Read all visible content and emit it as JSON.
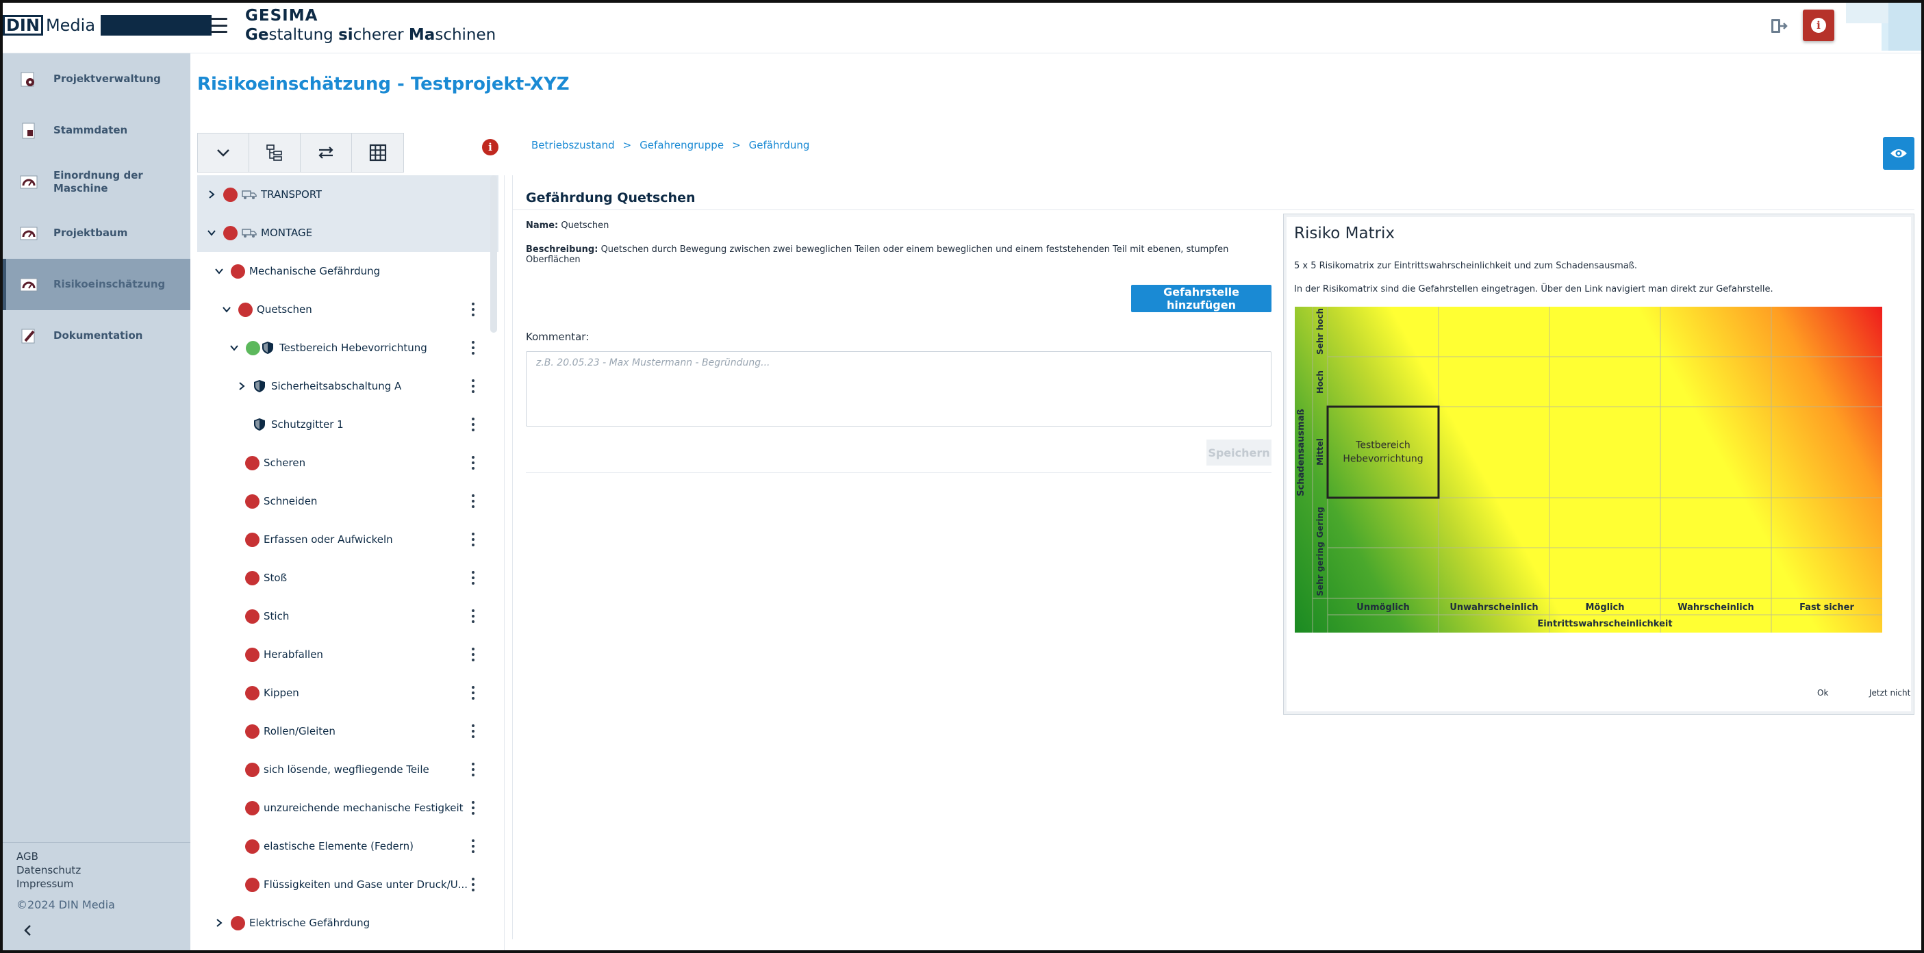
{
  "header": {
    "logo_din": "DIN",
    "logo_media": "Media",
    "app_name": "GESIMA",
    "subtitle_parts": [
      "Ge",
      "staltung ",
      "si",
      "cherer ",
      "Ma",
      "schinen"
    ]
  },
  "sidebar": {
    "items": [
      {
        "label": "Projektverwaltung",
        "icon": "gear-icon"
      },
      {
        "label": "Stammdaten",
        "icon": "file-icon"
      },
      {
        "label": "Einordnung der Maschine",
        "icon": "gauge-icon"
      },
      {
        "label": "Projektbaum",
        "icon": "gauge-icon"
      },
      {
        "label": "Risikoeinschätzung",
        "icon": "gauge-icon"
      },
      {
        "label": "Dokumentation",
        "icon": "pen-icon"
      }
    ],
    "footer": {
      "agb": "AGB",
      "datenschutz": "Datenschutz",
      "impressum": "Impressum",
      "copyright": "©2024 DIN Media"
    }
  },
  "main": {
    "title": "Risikoeinschätzung - Testprojekt-XYZ",
    "breadcrumb": [
      "Betriebszustand",
      "Gefahrengruppe",
      "Gefährdung"
    ],
    "breadcrumb_sep": ">"
  },
  "tree": {
    "rows": [
      {
        "label": "TRANSPORT",
        "level": 0
      },
      {
        "label": "MONTAGE",
        "level": 0
      },
      {
        "label": "Mechanische Gefährdung",
        "level": 1
      },
      {
        "label": "Quetschen",
        "level": 2
      },
      {
        "label": "Testbereich Hebevorrichtung",
        "level": 3
      },
      {
        "label": "Sicherheitsabschaltung A",
        "level": 4
      },
      {
        "label": "Schutzgitter 1",
        "level": 4
      },
      {
        "label": "Scheren",
        "level": 2
      },
      {
        "label": "Schneiden",
        "level": 2
      },
      {
        "label": "Erfassen oder Aufwickeln",
        "level": 2
      },
      {
        "label": "Stoß",
        "level": 2
      },
      {
        "label": "Stich",
        "level": 2
      },
      {
        "label": "Herabfallen",
        "level": 2
      },
      {
        "label": "Kippen",
        "level": 2
      },
      {
        "label": "Rollen/Gleiten",
        "level": 2
      },
      {
        "label": "sich lösende, wegfliegende Teile",
        "level": 2
      },
      {
        "label": "unzureichende mechanische Festigkeit",
        "level": 2
      },
      {
        "label": "elastische Elemente (Federn)",
        "level": 2
      },
      {
        "label": "Flüssigkeiten und Gase unter Druck/U...",
        "level": 2
      },
      {
        "label": "Elektrische Gefährdung",
        "level": 1
      }
    ]
  },
  "details": {
    "title": "Gefährdung Quetschen",
    "name_label": "Name:",
    "name_value": "Quetschen",
    "desc_label": "Beschreibung:",
    "desc_value": "Quetschen durch Bewegung zwischen zwei beweglichen Teilen oder einem beweglichen und einem feststehenden Teil mit ebenen, stumpfen Oberflächen",
    "add_button": "Gefahrstelle hinzufügen",
    "comment_label": "Kommentar:",
    "comment_placeholder": "z.B. 20.05.23 - Max Mustermann - Begründung...",
    "save_button": "Speichern"
  },
  "matrix": {
    "title": "Risiko Matrix",
    "text1": "5 x 5 Risikomatrix zur Eintrittswahrscheinlichkeit und zum Schadensausmaß.",
    "text2": "In der Risikomatrix sind die Gefahrstellen eingetragen. Über den Link navigiert man direkt zur Gefahrstelle.",
    "y_axis": "Schadensausmaß",
    "x_axis": "Eintrittswahrscheinlichkeit",
    "y_levels": [
      "Sehr hoch",
      "Hoch",
      "Mittel",
      "Gering",
      "Sehr gering"
    ],
    "x_levels": [
      "Unmöglich",
      "Unwahrscheinlich",
      "Möglich",
      "Wahrscheinlich",
      "Fast sicher"
    ],
    "marker_line1": "Testbereich",
    "marker_line2": "Hebevorrichtung",
    "marker_col": "Unmöglich",
    "marker_row": "Mittel",
    "ok": "Ok",
    "later": "Jetzt nicht"
  },
  "colors": {
    "accent": "#1a8ad4",
    "danger": "#c73234",
    "ok": "#5cb85c",
    "sidebar": "#c9d5e0"
  }
}
